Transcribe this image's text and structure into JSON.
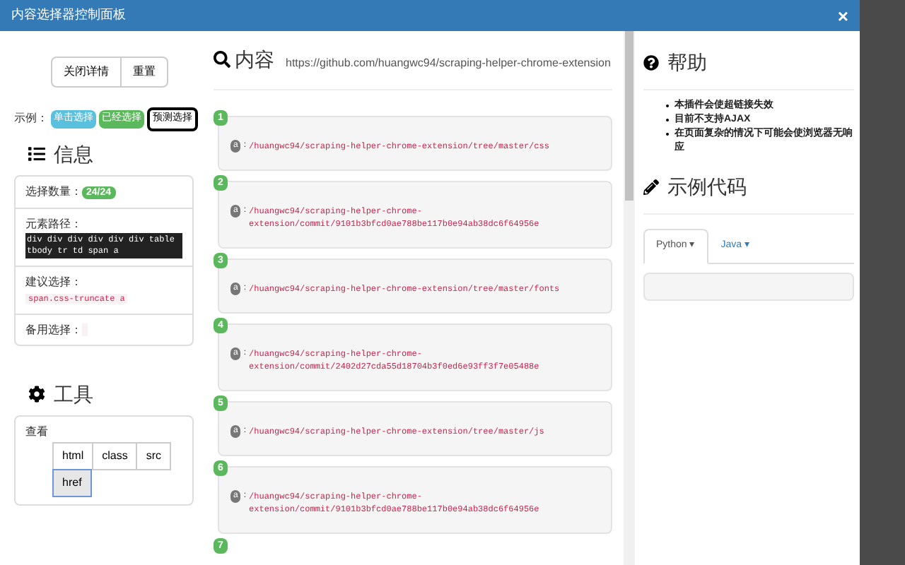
{
  "window": {
    "title": "内容选择器控制面板",
    "close": "×"
  },
  "top_buttons": [
    "关闭详情",
    "重置"
  ],
  "legend": {
    "label": "示例：",
    "items": [
      {
        "text": "单击选择",
        "kind": "click"
      },
      {
        "text": "已经选择",
        "kind": "selected"
      },
      {
        "text": "预测选择",
        "kind": "predicted"
      }
    ]
  },
  "info": {
    "title": "信息",
    "rows": [
      {
        "label": "选择数量：",
        "kind": "badge",
        "value": "24/24"
      },
      {
        "label": "元素路径：",
        "kind": "path",
        "value": "div div div div div div table tbody tr td span a"
      },
      {
        "label": "建议选择：",
        "kind": "code",
        "value": "span.css-truncate a"
      },
      {
        "label": "备用选择：",
        "kind": "code",
        "value": ""
      }
    ]
  },
  "tools": {
    "title": "工具",
    "label": "查看",
    "buttons": [
      {
        "text": "html",
        "selected": false
      },
      {
        "text": "class",
        "selected": false
      },
      {
        "text": "src",
        "selected": false
      },
      {
        "text": "href",
        "selected": true
      }
    ]
  },
  "content": {
    "title": "内容",
    "url": "https://github.com/huangwc94/scraping-helper-chrome-extension",
    "items": [
      {
        "number": "1",
        "tag": "a",
        "separator": ":",
        "value": "/huangwc94/scraping-helper-chrome-extension/tree/master/css"
      },
      {
        "number": "2",
        "tag": "a",
        "separator": ":",
        "value": "/huangwc94/scraping-helper-chrome-extension/commit/9101b3bfcd0ae788be117b0e94ab38dc6f64956e"
      },
      {
        "number": "3",
        "tag": "a",
        "separator": ":",
        "value": "/huangwc94/scraping-helper-chrome-extension/tree/master/fonts"
      },
      {
        "number": "4",
        "tag": "a",
        "separator": ":",
        "value": "/huangwc94/scraping-helper-chrome-extension/commit/2402d27cda55d18704b3f0ed6e93ff3f7e05488e"
      },
      {
        "number": "5",
        "tag": "a",
        "separator": ":",
        "value": "/huangwc94/scraping-helper-chrome-extension/tree/master/js"
      },
      {
        "number": "6",
        "tag": "a",
        "separator": ":",
        "value": "/huangwc94/scraping-helper-chrome-extension/commit/9101b3bfcd0ae788be117b0e94ab38dc6f64956e"
      },
      {
        "number": "7"
      }
    ]
  },
  "help": {
    "title": "帮助",
    "items": [
      "本插件会使超链接失效",
      "目前不支持AJAX",
      "在页面复杂的情况下可能会使浏览器无响应"
    ]
  },
  "code": {
    "title": "示例代码",
    "tabs": [
      {
        "text": "Python",
        "caret": "▾",
        "selected": true
      },
      {
        "text": "Java",
        "caret": "▾",
        "selected": false
      }
    ]
  }
}
